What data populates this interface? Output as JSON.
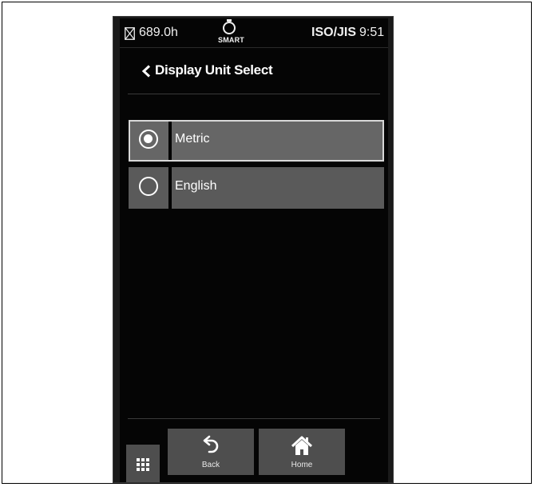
{
  "status_bar": {
    "hours": "689.0h",
    "smart_label": "SMART",
    "standard": "ISO/JIS",
    "time": "9:51"
  },
  "header": {
    "title": "Display Unit Select"
  },
  "options": [
    {
      "label": "Metric",
      "selected": true
    },
    {
      "label": "English",
      "selected": false
    }
  ],
  "bottom_nav": {
    "back_label": "Back",
    "home_label": "Home"
  },
  "icons": [
    "hourglass-icon",
    "engine-smart-icon",
    "chevron-left-icon",
    "radio-selected-icon",
    "radio-unselected-icon",
    "grid-menu-icon",
    "undo-arrow-icon",
    "home-icon"
  ]
}
